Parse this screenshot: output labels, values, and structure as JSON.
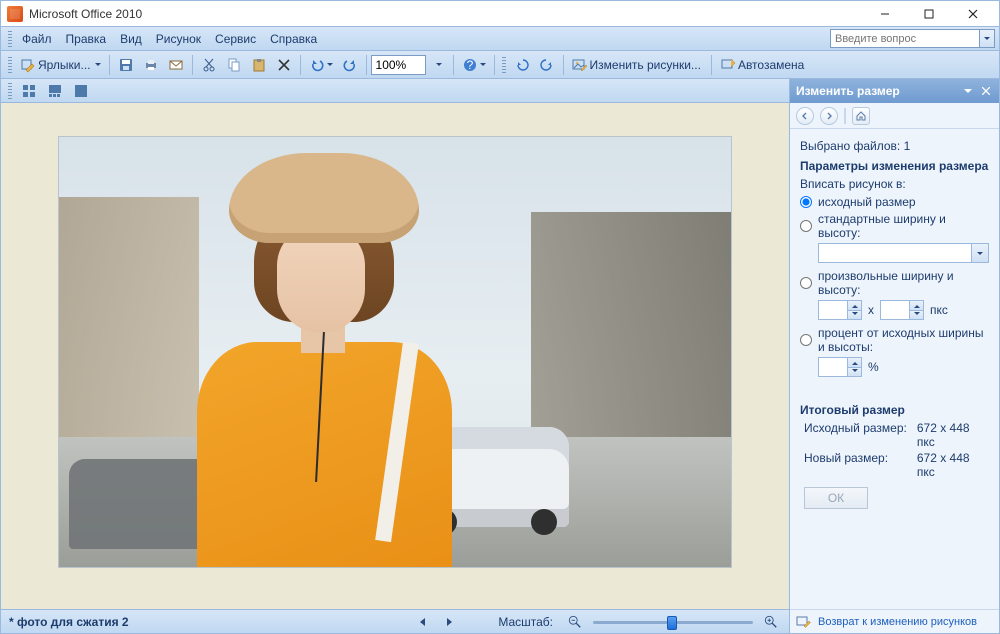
{
  "title": "Microsoft Office 2010",
  "question_placeholder": "Введите вопрос",
  "menu": [
    "Файл",
    "Правка",
    "Вид",
    "Рисунок",
    "Сервис",
    "Справка"
  ],
  "toolbar": {
    "shortcuts_label": "Ярлыки...",
    "zoom_value": "100%",
    "edit_images_label": "Изменить рисунки...",
    "autoreplace_label": "Автозамена"
  },
  "panel": {
    "title": "Изменить размер",
    "selected_files_label": "Выбрано файлов:",
    "selected_files_count": "1",
    "params_heading": "Параметры изменения размера",
    "fit_into_label": "Вписать рисунок в:",
    "radio_original": "исходный размер",
    "radio_standard": "стандартные ширину и высоту:",
    "radio_custom": "произвольные ширину и высоту:",
    "px_unit": "пкс",
    "x_sep": "x",
    "radio_percent": "процент от исходных ширины и высоты:",
    "percent_sign": "%",
    "result_heading": "Итоговый размер",
    "orig_size_label": "Исходный размер:",
    "orig_size_value": "672 x 448 пкс",
    "new_size_label": "Новый размер:",
    "new_size_value": "672 x 448 пкс",
    "ok_label": "ОК",
    "back_link": "Возврат к изменению рисунков"
  },
  "status": {
    "filename": "* фото для сжатия 2",
    "zoom_label": "Масштаб:"
  }
}
